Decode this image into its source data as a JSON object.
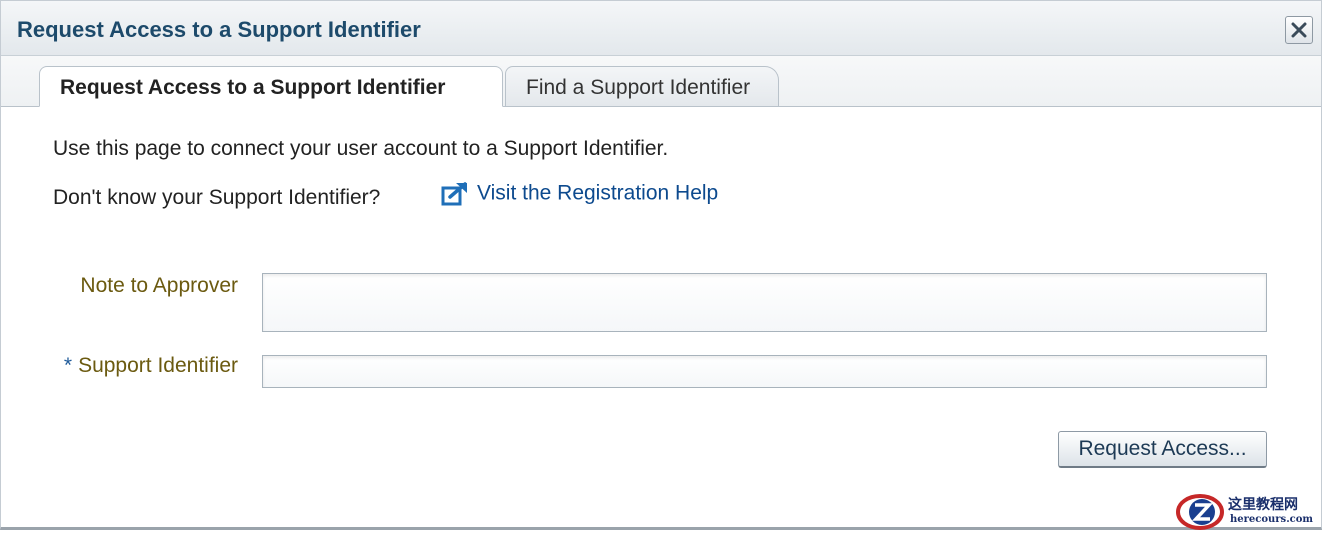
{
  "dialog": {
    "title": "Request Access to a Support Identifier",
    "close_icon": "close-icon"
  },
  "tabs": [
    {
      "label": "Request Access to a Support Identifier",
      "active": true
    },
    {
      "label": "Find a Support Identifier",
      "active": false
    }
  ],
  "content": {
    "intro_text": "Use this page to connect your user account to a Support Identifier.",
    "help_question": "Don't know your Support Identifier?",
    "help_link_label": "Visit the Registration Help",
    "help_link_icon": "external-link-icon"
  },
  "form": {
    "note_label": "Note to Approver",
    "note_value": "",
    "support_required_marker": "*",
    "support_label": "Support Identifier",
    "support_value": "",
    "submit_label": "Request Access..."
  },
  "watermark": {
    "chinese_text": "这里教程网",
    "site": "herecours.com"
  },
  "colors": {
    "title": "#1d4a6b",
    "link": "#0d4a8e",
    "label": "#6b5a10",
    "required": "#1f5b9a"
  }
}
